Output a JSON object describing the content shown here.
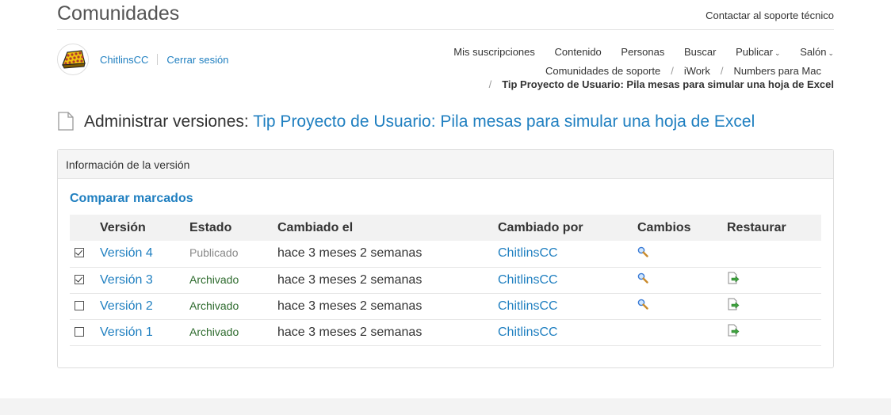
{
  "header": {
    "site_title": "Comunidades",
    "contact_link": "Contactar al soporte técnico"
  },
  "user": {
    "name": "ChitlinsCC",
    "logout": "Cerrar sesión"
  },
  "nav": {
    "items": [
      {
        "label": "Mis suscripciones"
      },
      {
        "label": "Contenido"
      },
      {
        "label": "Personas"
      },
      {
        "label": "Buscar"
      },
      {
        "label": "Publicar",
        "has_menu": true
      },
      {
        "label": "Salón",
        "has_menu": true
      }
    ]
  },
  "breadcrumb": {
    "items": [
      "Comunidades de soporte",
      "iWork",
      "Numbers para Mac"
    ],
    "current": "Tip Proyecto de Usuario: Pila mesas para simular una hoja de Excel"
  },
  "page": {
    "title_prefix": "Administrar versiones:",
    "title_link": "Tip Proyecto de Usuario: Pila mesas para simular una hoja de Excel"
  },
  "panel": {
    "header": "Información de la versión",
    "compare_label": "Comparar marcados",
    "columns": [
      "Versión",
      "Estado",
      "Cambiado el",
      "Cambiado por",
      "Cambios",
      "Restaurar"
    ],
    "rows": [
      {
        "checked": true,
        "version": "Versión 4",
        "status": "Publicado",
        "changed_on": "hace 3 meses 2 semanas",
        "changed_by": "ChitlinsCC",
        "has_changes": true,
        "restore": false
      },
      {
        "checked": true,
        "version": "Versión 3",
        "status": "Archivado",
        "changed_on": "hace 3 meses 2 semanas",
        "changed_by": "ChitlinsCC",
        "has_changes": true,
        "restore": true
      },
      {
        "checked": false,
        "version": "Versión 2",
        "status": "Archivado",
        "changed_on": "hace 3 meses 2 semanas",
        "changed_by": "ChitlinsCC",
        "has_changes": true,
        "restore": true
      },
      {
        "checked": false,
        "version": "Versión 1",
        "status": "Archivado",
        "changed_on": "hace 3 meses 2 semanas",
        "changed_by": "ChitlinsCC",
        "has_changes": false,
        "restore": true
      }
    ]
  },
  "colors": {
    "link": "#1f7fc0",
    "archived": "#2e6b2e",
    "published": "#888888"
  }
}
